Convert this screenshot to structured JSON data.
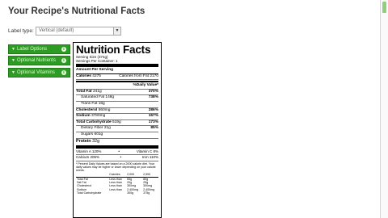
{
  "page": {
    "title": "Your Recipe's Nutritional Facts"
  },
  "label_type": {
    "label": "Label type:",
    "selected": "Vertical (default)"
  },
  "side_buttons": [
    {
      "label": "Label Options"
    },
    {
      "label": "Optional Nutrients"
    },
    {
      "label": "Optional Vitamins"
    }
  ],
  "colors": {
    "accent_green": "#2e9b24",
    "scroll_thumb": "#8fd17a"
  },
  "icons": {
    "caret": "triangle-down-icon",
    "info": "info-circle-icon",
    "select_arrow": "chevron-down-icon"
  },
  "label": {
    "title": "Nutrition Facts",
    "serving_size": "Serving Size (374g)",
    "servings": "Servings Per Container: 1",
    "amount_per": "Amount Per Serving",
    "calories": "Calories",
    "calories_value": "4275",
    "calories_fat": "Calories from Fat 2170",
    "dv_header": "%Daily Value*",
    "rows": [
      {
        "name": "Total Fat",
        "amount": "241g",
        "dv": "370%",
        "bold": true,
        "indent": false
      },
      {
        "name": "Saturated Fat",
        "amount": "148g",
        "dv": "738%",
        "bold": false,
        "indent": true
      },
      {
        "name": "Trans Fat",
        "amount": "16g",
        "dv": "",
        "bold": false,
        "indent": true
      },
      {
        "name": "Cholesterol",
        "amount": "860mg",
        "dv": "286%",
        "bold": true,
        "indent": false
      },
      {
        "name": "Sodium",
        "amount": "3780mg",
        "dv": "157%",
        "bold": true,
        "indent": false
      },
      {
        "name": "Total Carbohydrate",
        "amount": "519g",
        "dv": "173%",
        "bold": true,
        "indent": false
      },
      {
        "name": "Dietary Fiber",
        "amount": "21g",
        "dv": "85%",
        "bold": false,
        "indent": true
      },
      {
        "name": "Sugars",
        "amount": "601g",
        "dv": "",
        "bold": false,
        "indent": true
      }
    ],
    "protein": {
      "name": "Protein",
      "amount": "32g"
    },
    "vitamins": [
      {
        "left": "Vitamin A 120%",
        "right": "Vitamin C 8%"
      },
      {
        "left": "Calcium 205%",
        "right": "Iron 110%"
      }
    ],
    "footnote": "* Percent Daily Values are based on a 2000 calorie diet. Your daily values may be higher or lower depending on your calorie needs.",
    "dv_table": {
      "header": [
        "",
        "Calories:",
        "2,000",
        "2,500"
      ],
      "rows": [
        [
          "Total Fat",
          "Less than",
          "65g",
          "80g"
        ],
        [
          "Sat Fat",
          "Less than",
          "20g",
          "25g"
        ],
        [
          "Cholesterol",
          "Less than",
          "300mg",
          "300mg"
        ],
        [
          "Sodium",
          "Less than",
          "2,400mg",
          "2,400mg"
        ],
        [
          "Total Carbohydrate",
          "",
          "300g",
          "375g"
        ]
      ]
    }
  }
}
